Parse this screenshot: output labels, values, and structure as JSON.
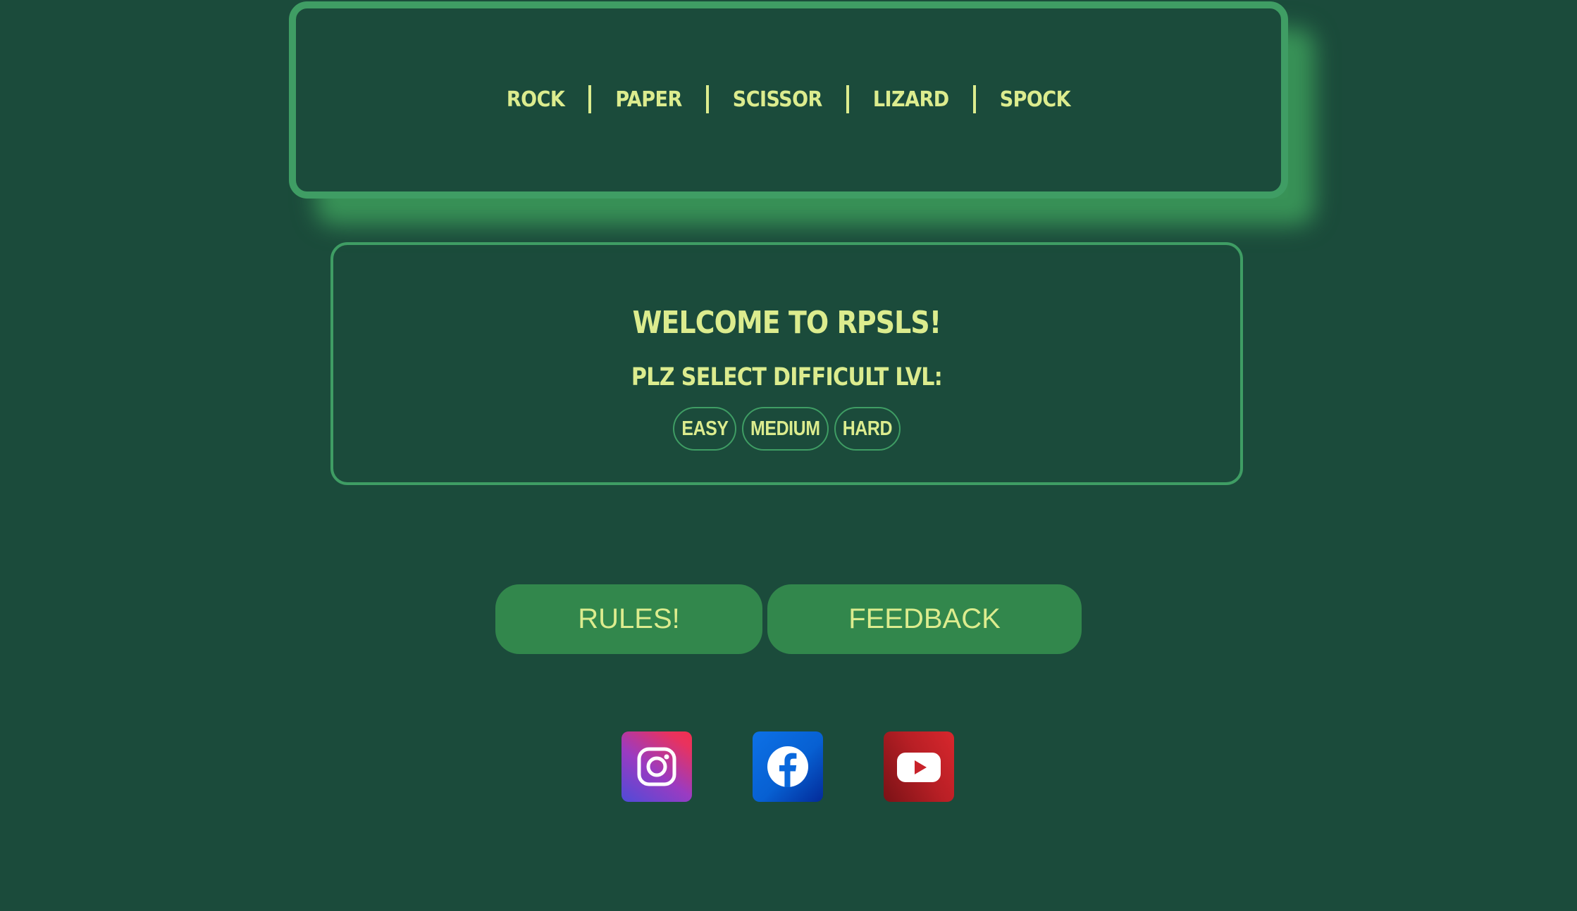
{
  "nav": {
    "items": [
      "ROCK",
      "PAPER",
      "SCISSOR",
      "LIZARD",
      "SPOCK"
    ]
  },
  "welcome": {
    "title": "WELCOME TO RPSLS!",
    "select_label": "PLZ SELECT DIFFICULT LVL:",
    "difficulties": [
      "EASY",
      "MEDIUM",
      "HARD"
    ]
  },
  "actions": {
    "rules_label": "RULES!",
    "feedback_label": "FEEDBACK"
  },
  "social": {
    "icons": [
      "instagram-icon",
      "facebook-icon",
      "youtube-icon"
    ]
  },
  "colors": {
    "background": "#1b4b3b",
    "accent_green": "#3f9d64",
    "button_green": "#32874c",
    "text_yellow": "#dcec8e"
  }
}
